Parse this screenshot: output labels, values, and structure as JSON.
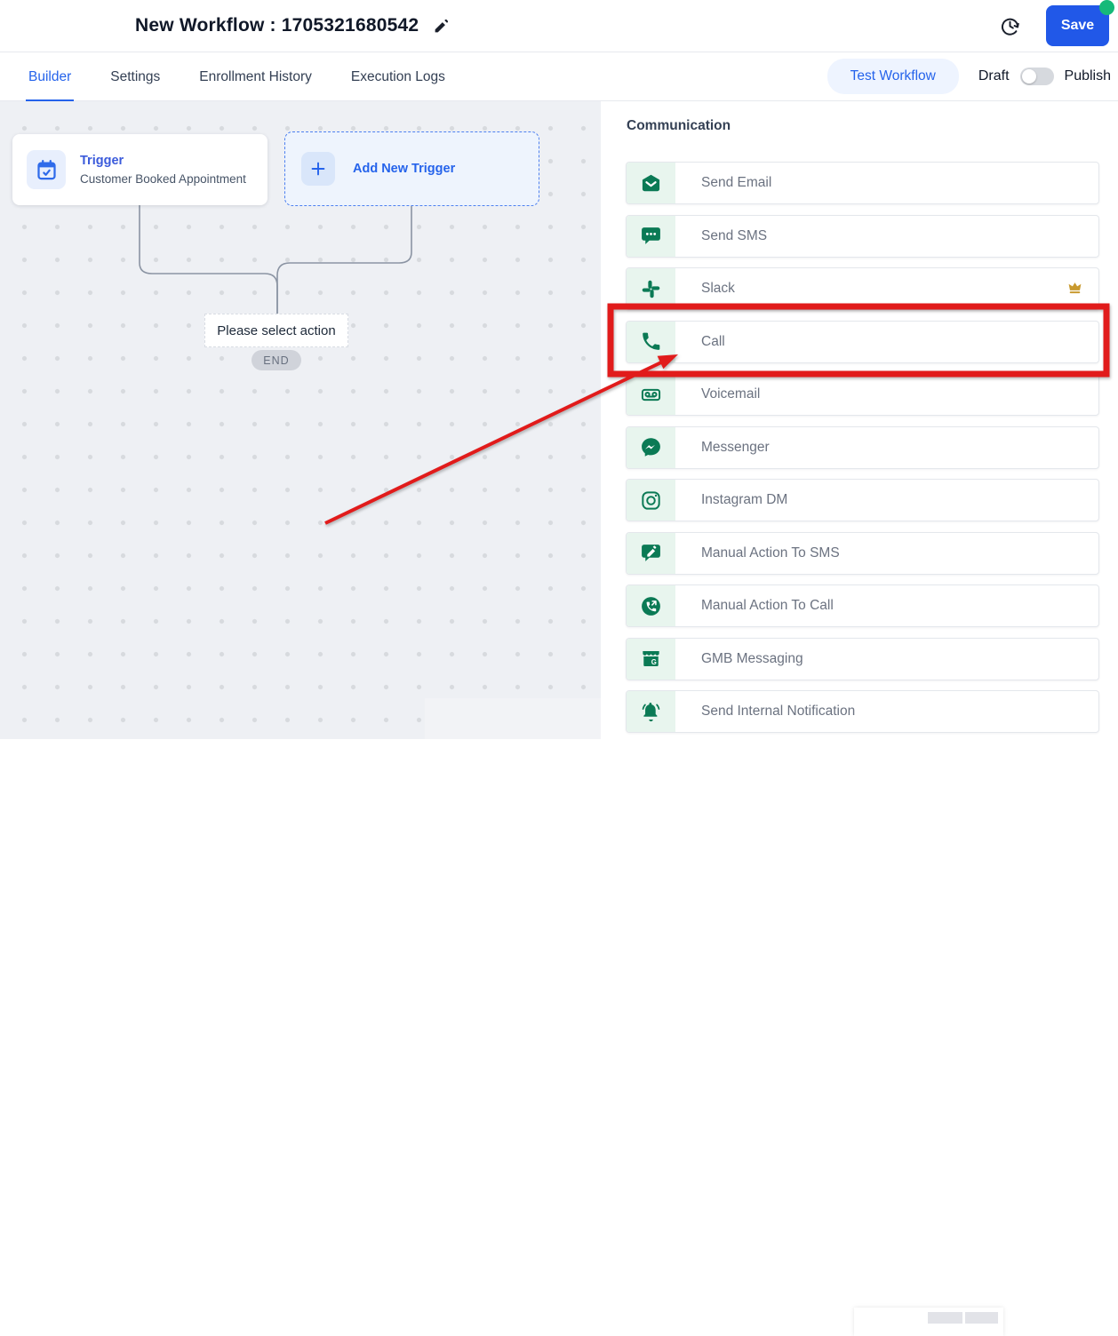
{
  "header": {
    "title": "New Workflow : 1705321680542",
    "save_label": "Save",
    "icons": {
      "edit": "edit-pencil-icon",
      "history": "history-clock-icon",
      "unsaved_dot": "status-dot-green"
    }
  },
  "tabs": {
    "items": [
      "Builder",
      "Settings",
      "Enrollment History",
      "Execution Logs"
    ],
    "active": "Builder",
    "test_workflow_label": "Test Workflow",
    "draft_label": "Draft",
    "publish_label": "Publish",
    "toggle_state": "draft"
  },
  "canvas": {
    "trigger_card": {
      "title": "Trigger",
      "subtitle": "Customer Booked Appointment",
      "icon": "calendar-check-icon"
    },
    "add_trigger": {
      "label": "Add New Trigger",
      "icon": "plus-icon"
    },
    "placeholder": {
      "label": "Please select action"
    },
    "end_label": "END"
  },
  "sidebar": {
    "heading": "Communication",
    "items": [
      {
        "label": "Send Email",
        "icon": "email-icon"
      },
      {
        "label": "Send SMS",
        "icon": "sms-icon"
      },
      {
        "label": "Slack",
        "icon": "slack-icon",
        "premium": true
      },
      {
        "label": "Call",
        "icon": "call-icon",
        "highlighted": true
      },
      {
        "label": "Voicemail",
        "icon": "voicemail-icon"
      },
      {
        "label": "Messenger",
        "icon": "messenger-icon"
      },
      {
        "label": "Instagram DM",
        "icon": "instagram-icon"
      },
      {
        "label": "Manual Action To SMS",
        "icon": "manual-sms-icon"
      },
      {
        "label": "Manual Action To Call",
        "icon": "manual-call-icon"
      },
      {
        "label": "GMB Messaging",
        "icon": "gmb-storefront-icon"
      },
      {
        "label": "Send Internal Notification",
        "icon": "notification-bell-icon"
      }
    ]
  },
  "annotation": {
    "type": "red-box-and-arrow",
    "highlight_target": "Call"
  },
  "colors": {
    "accent_blue": "#2563eb",
    "save_blue": "#2158e8",
    "icon_green": "#0b7a55",
    "icon_strip_green": "#e8f5ee",
    "annotation_red": "#e11b1b",
    "premium_gold": "#c8992e",
    "status_dot_green": "#16b979",
    "canvas_bg": "#eef0f4"
  }
}
